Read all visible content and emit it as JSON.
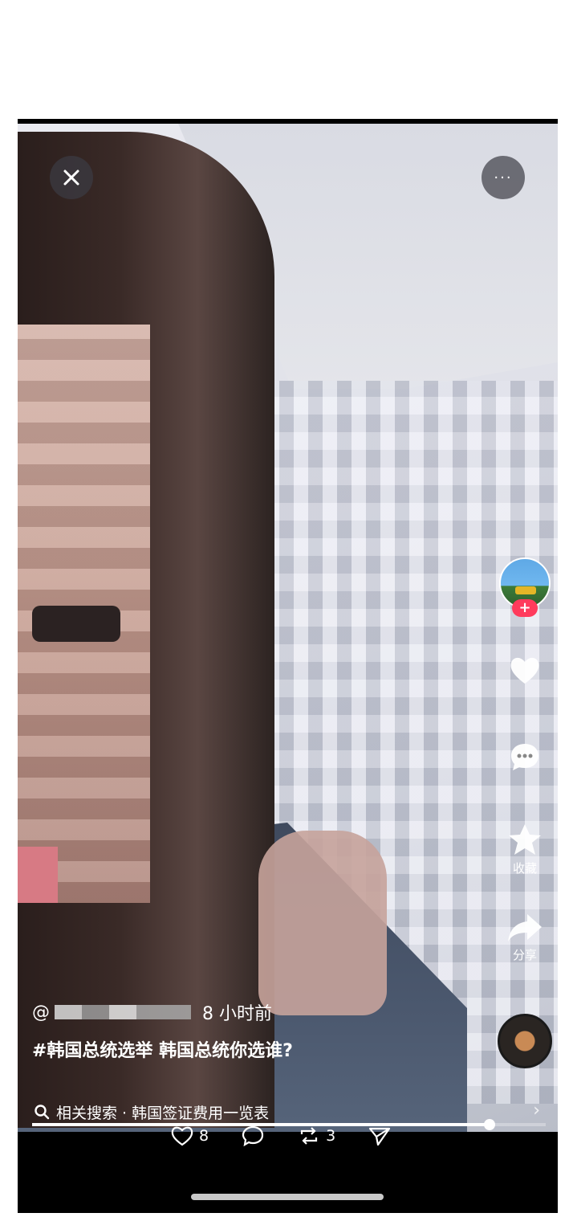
{
  "top_bar": {
    "more_label": "···"
  },
  "side_rail": {
    "follow_label": "+",
    "collect_label": "收藏",
    "share_label": "分享"
  },
  "post": {
    "author_prefix": "@",
    "time_ago": "8 小时前",
    "caption": "#韩国总统选举 韩国总统你选谁?"
  },
  "related_search": {
    "text": "相关搜索 · 韩国签证费用一览表"
  },
  "actions": {
    "likes": "8",
    "reposts": "3"
  },
  "progress": {
    "played_fraction": 0.89
  },
  "colors": {
    "follow_badge": "#ff3b5c",
    "screen_bg": "#000000"
  }
}
